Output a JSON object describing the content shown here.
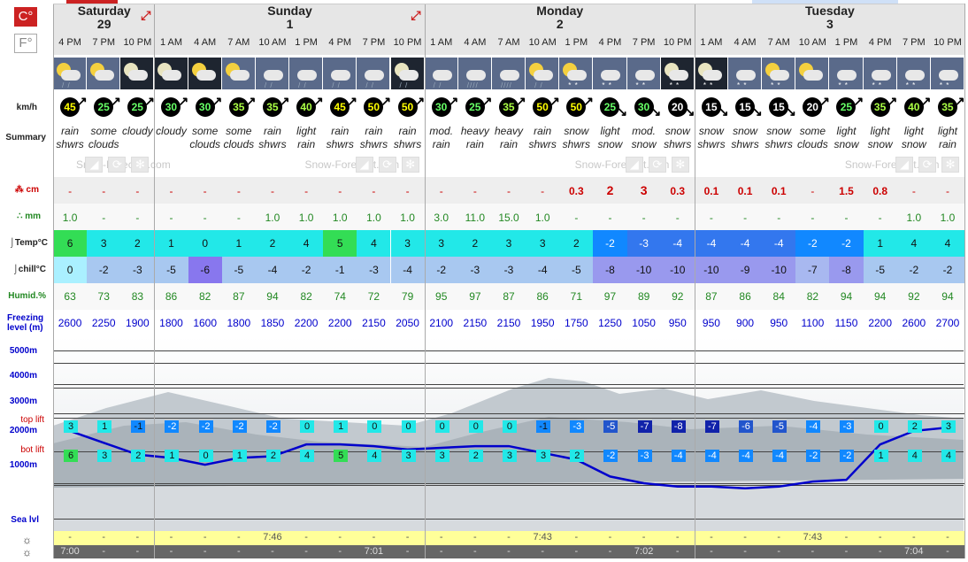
{
  "units": {
    "celsius": "C°",
    "fahrenheit": "F°"
  },
  "days": [
    {
      "name": "Saturday",
      "date": "29"
    },
    {
      "name": "Sunday",
      "date": "1"
    },
    {
      "name": "Monday",
      "date": "2"
    },
    {
      "name": "Tuesday",
      "date": "3"
    }
  ],
  "times": [
    "4 PM",
    "7 PM",
    "10 PM",
    "1 AM",
    "4 AM",
    "7 AM",
    "10 AM",
    "1 PM",
    "4 PM",
    "7 PM",
    "10 PM",
    "1 AM",
    "4 AM",
    "7 AM",
    "10 AM",
    "1 PM",
    "4 PM",
    "7 PM",
    "10 PM",
    "1 AM",
    "4 AM",
    "7 AM",
    "10 AM",
    "1 PM",
    "4 PM",
    "7 PM",
    "10 PM"
  ],
  "labels": {
    "wind": "km/h",
    "summary": "Summary",
    "snow": "cm",
    "rain": "mm",
    "temp": "Temp°C",
    "chill": "chill°C",
    "humid": "Humid.%",
    "freezing": "Freezing level (m)",
    "alt5000": "5000m",
    "alt4000": "4000m",
    "alt3000": "3000m",
    "alt2000": "2000m",
    "alt1000": "1000m",
    "sealvl": "Sea lvl",
    "toplift": "top lift",
    "botlift": "bot lift"
  },
  "watermark": "Snow-Forecast.com",
  "icons": [
    "sun-cloud-rain",
    "sun-cloud",
    "cloud-night",
    "cloud-night",
    "sun-cloud-night",
    "sun-cloud",
    "cloud-rain",
    "cloud-rain",
    "cloud-rain",
    "cloud-rain",
    "cloud-night-rain",
    "cloud-rain",
    "cloud-heavy-rain",
    "cloud-heavy-rain",
    "sun-cloud-rain",
    "sun-cloud-snow",
    "cloud-snow",
    "cloud-snow",
    "cloud-night-snow",
    "cloud-night-snow",
    "cloud-snow",
    "sun-cloud-snow",
    "sun-cloud",
    "cloud-snow",
    "cloud-snow",
    "cloud-snow",
    "cloud-snow"
  ],
  "wind": [
    "45",
    "25",
    "25",
    "30",
    "30",
    "35",
    "35",
    "40",
    "45",
    "50",
    "50",
    "30",
    "25",
    "35",
    "50",
    "50",
    "25",
    "30",
    "20",
    "15",
    "15",
    "15",
    "20",
    "25",
    "35",
    "40",
    "35"
  ],
  "summary": [
    [
      "rain",
      "shwrs"
    ],
    [
      "some",
      "clouds"
    ],
    [
      "cloudy",
      ""
    ],
    [
      "cloudy",
      ""
    ],
    [
      "some",
      "clouds"
    ],
    [
      "some",
      "clouds"
    ],
    [
      "rain",
      "shwrs"
    ],
    [
      "light",
      "rain"
    ],
    [
      "rain",
      "shwrs"
    ],
    [
      "rain",
      "shwrs"
    ],
    [
      "rain",
      "shwrs"
    ],
    [
      "mod.",
      "rain"
    ],
    [
      "heavy",
      "rain"
    ],
    [
      "heavy",
      "rain"
    ],
    [
      "rain",
      "shwrs"
    ],
    [
      "snow",
      "shwrs"
    ],
    [
      "light",
      "snow"
    ],
    [
      "mod.",
      "snow"
    ],
    [
      "snow",
      "shwrs"
    ],
    [
      "snow",
      "shwrs"
    ],
    [
      "snow",
      "shwrs"
    ],
    [
      "snow",
      "shwrs"
    ],
    [
      "some",
      "clouds"
    ],
    [
      "light",
      "snow"
    ],
    [
      "light",
      "snow"
    ],
    [
      "light",
      "snow"
    ],
    [
      "light",
      "rain"
    ]
  ],
  "snow": [
    "-",
    "-",
    "-",
    "-",
    "-",
    "-",
    "-",
    "-",
    "-",
    "-",
    "-",
    "-",
    "-",
    "-",
    "-",
    "0.3",
    "2",
    "3",
    "0.3",
    "0.1",
    "0.1",
    "0.1",
    "-",
    "1.5",
    "0.8",
    "-",
    "-"
  ],
  "rain": [
    "1.0",
    "-",
    "-",
    "-",
    "-",
    "-",
    "1.0",
    "1.0",
    "1.0",
    "1.0",
    "1.0",
    "3.0",
    "11.0",
    "15.0",
    "1.0",
    "-",
    "-",
    "-",
    "-",
    "-",
    "-",
    "-",
    "-",
    "-",
    "-",
    "1.0",
    "1.0"
  ],
  "temp": [
    "6",
    "3",
    "2",
    "1",
    "0",
    "1",
    "2",
    "4",
    "5",
    "4",
    "3",
    "3",
    "2",
    "3",
    "3",
    "2",
    "-2",
    "-3",
    "-4",
    "-4",
    "-4",
    "-4",
    "-2",
    "-2",
    "1",
    "4",
    "4"
  ],
  "chill": [
    "0",
    "-2",
    "-3",
    "-5",
    "-6",
    "-5",
    "-4",
    "-2",
    "-1",
    "-3",
    "-4",
    "-2",
    "-3",
    "-3",
    "-4",
    "-5",
    "-8",
    "-10",
    "-10",
    "-10",
    "-9",
    "-10",
    "-7",
    "-8",
    "-5",
    "-2",
    "-2"
  ],
  "humid": [
    "63",
    "73",
    "83",
    "86",
    "82",
    "87",
    "94",
    "82",
    "74",
    "72",
    "79",
    "95",
    "97",
    "87",
    "86",
    "71",
    "97",
    "89",
    "92",
    "87",
    "86",
    "84",
    "82",
    "94",
    "94",
    "92",
    "94"
  ],
  "freezing": [
    "2600",
    "2250",
    "1900",
    "1800",
    "1600",
    "1800",
    "1850",
    "2200",
    "2200",
    "2150",
    "2050",
    "2100",
    "2150",
    "2150",
    "1950",
    "1750",
    "1250",
    "1050",
    "950",
    "950",
    "900",
    "950",
    "1100",
    "1150",
    "2200",
    "2600",
    "2700"
  ],
  "toplift": [
    "3",
    "1",
    "-1",
    "-2",
    "-2",
    "-2",
    "-2",
    "0",
    "1",
    "0",
    "0",
    "0",
    "0",
    "0",
    "-1",
    "-3",
    "-5",
    "-7",
    "-8",
    "-7",
    "-6",
    "-5",
    "-4",
    "-3",
    "0",
    "2",
    "3"
  ],
  "botlift": [
    "6",
    "3",
    "2",
    "1",
    "0",
    "1",
    "2",
    "4",
    "5",
    "4",
    "3",
    "3",
    "2",
    "3",
    "3",
    "2",
    "-2",
    "-3",
    "-4",
    "-4",
    "-4",
    "-4",
    "-2",
    "-2",
    "1",
    "4",
    "4"
  ],
  "sunrise": [
    "-",
    "-",
    "-",
    "-",
    "-",
    "-",
    "7:46",
    "-",
    "-",
    "-",
    "-",
    "-",
    "-",
    "-",
    "7:43",
    "-",
    "-",
    "-",
    "-",
    "-",
    "-",
    "-",
    "7:43",
    "-",
    "-",
    "-",
    "-"
  ],
  "sunset": [
    "7:00",
    "-",
    "-",
    "-",
    "-",
    "-",
    "-",
    "-",
    "-",
    "7:01",
    "-",
    "-",
    "-",
    "-",
    "-",
    "-",
    "-",
    "7:02",
    "-",
    "-",
    "-",
    "-",
    "-",
    "-",
    "-",
    "7:04",
    "-"
  ],
  "colors": {
    "header": "#e6e6e6",
    "sunriseBar": "#ffff99",
    "sunsetBar": "#666666",
    "freezingLine": "#0000cc",
    "snowRed": "#cc0000",
    "rainGreen": "#228822",
    "blueText": "#0000cc"
  }
}
